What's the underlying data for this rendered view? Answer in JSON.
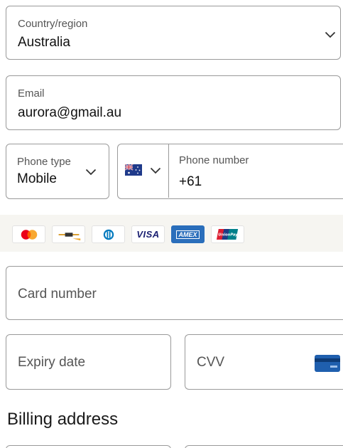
{
  "country": {
    "label": "Country/region",
    "value": "Australia"
  },
  "email": {
    "label": "Email",
    "value": "aurora@gmail.au"
  },
  "phone_type": {
    "label": "Phone type",
    "value": "Mobile"
  },
  "phone_number": {
    "label": "Phone number",
    "value": "+61",
    "flag": "australia-flag-icon"
  },
  "card_brands": [
    "mastercard-icon",
    "maestro-icon",
    "diners-club-icon",
    "visa-icon",
    "amex-icon",
    "unionpay-icon"
  ],
  "card_number": {
    "placeholder": "Card number"
  },
  "expiry": {
    "placeholder": "Expiry date"
  },
  "cvv": {
    "placeholder": "CVV",
    "icon": "card-back-icon"
  },
  "billing": {
    "heading": "Billing address"
  },
  "brand_text": {
    "visa": "VISA",
    "amex": "AMEX",
    "unionpay": "UnionPay"
  },
  "colors": {
    "border": "#9a9a9a",
    "strip_bg": "#f6f5f1",
    "amex_blue": "#2a6ebb",
    "mc_red": "#eb001b",
    "mc_orange": "#f79e1b",
    "visa_navy": "#1a1f71",
    "cvv_blue": "#1f5fae"
  }
}
